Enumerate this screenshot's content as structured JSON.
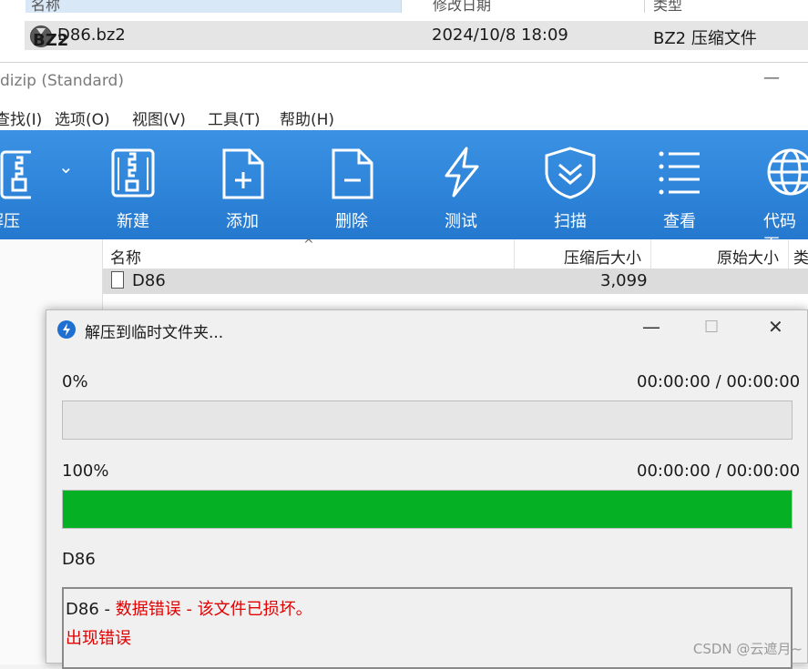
{
  "explorer": {
    "header": {
      "name_col": "名称",
      "date_col": "修改日期",
      "type_col": "类型"
    },
    "file": {
      "icon_label": "BZ2",
      "name": "D86.bz2",
      "date": "2024/10/8 18:09",
      "type": "BZ2 压缩文件"
    }
  },
  "window": {
    "title": "dizip (Standard)",
    "minimize": "—"
  },
  "menu": [
    "查找(I)",
    "选项(O)",
    "视图(V)",
    "工具(T)",
    "帮助(H)"
  ],
  "toolbar": {
    "items": [
      {
        "label": "解压",
        "icon": "extract-icon"
      },
      {
        "label": "新建",
        "icon": "new-archive-icon"
      },
      {
        "label": "添加",
        "icon": "add-file-icon"
      },
      {
        "label": "删除",
        "icon": "delete-file-icon"
      },
      {
        "label": "测试",
        "icon": "test-lightning-icon"
      },
      {
        "label": "扫描",
        "icon": "scan-shield-icon"
      },
      {
        "label": "查看",
        "icon": "view-list-icon"
      },
      {
        "label": "代码页",
        "icon": "codepage-globe-icon"
      }
    ],
    "dropdown": "⌄",
    "bg_color": "#2f86db"
  },
  "filelist": {
    "columns": {
      "name": "名称",
      "packed": "压缩后大小",
      "original": "原始大小",
      "type": "类"
    },
    "sort_arrow": "^",
    "rows": [
      {
        "name": "D86",
        "packed": "3,099",
        "original": ""
      }
    ]
  },
  "dialog": {
    "title": "解压到临时文件夹...",
    "controls": {
      "minimize": "—",
      "maximize": "☐",
      "close": "✕"
    },
    "progress1": {
      "percent_label": "0%",
      "time": "00:00:00 / 00:00:00",
      "value": 0
    },
    "progress2": {
      "percent_label": "100%",
      "time": "00:00:00 / 00:00:00",
      "value": 1.0
    },
    "current_file": "D86",
    "log": {
      "file": "D86",
      "separator": " - ",
      "error": "数据错误 - 该文件已损坏。",
      "line2": "出现错误"
    },
    "bar_color": "#06b025",
    "error_color": "#e00000"
  },
  "watermark": "CSDN @云遮月~"
}
